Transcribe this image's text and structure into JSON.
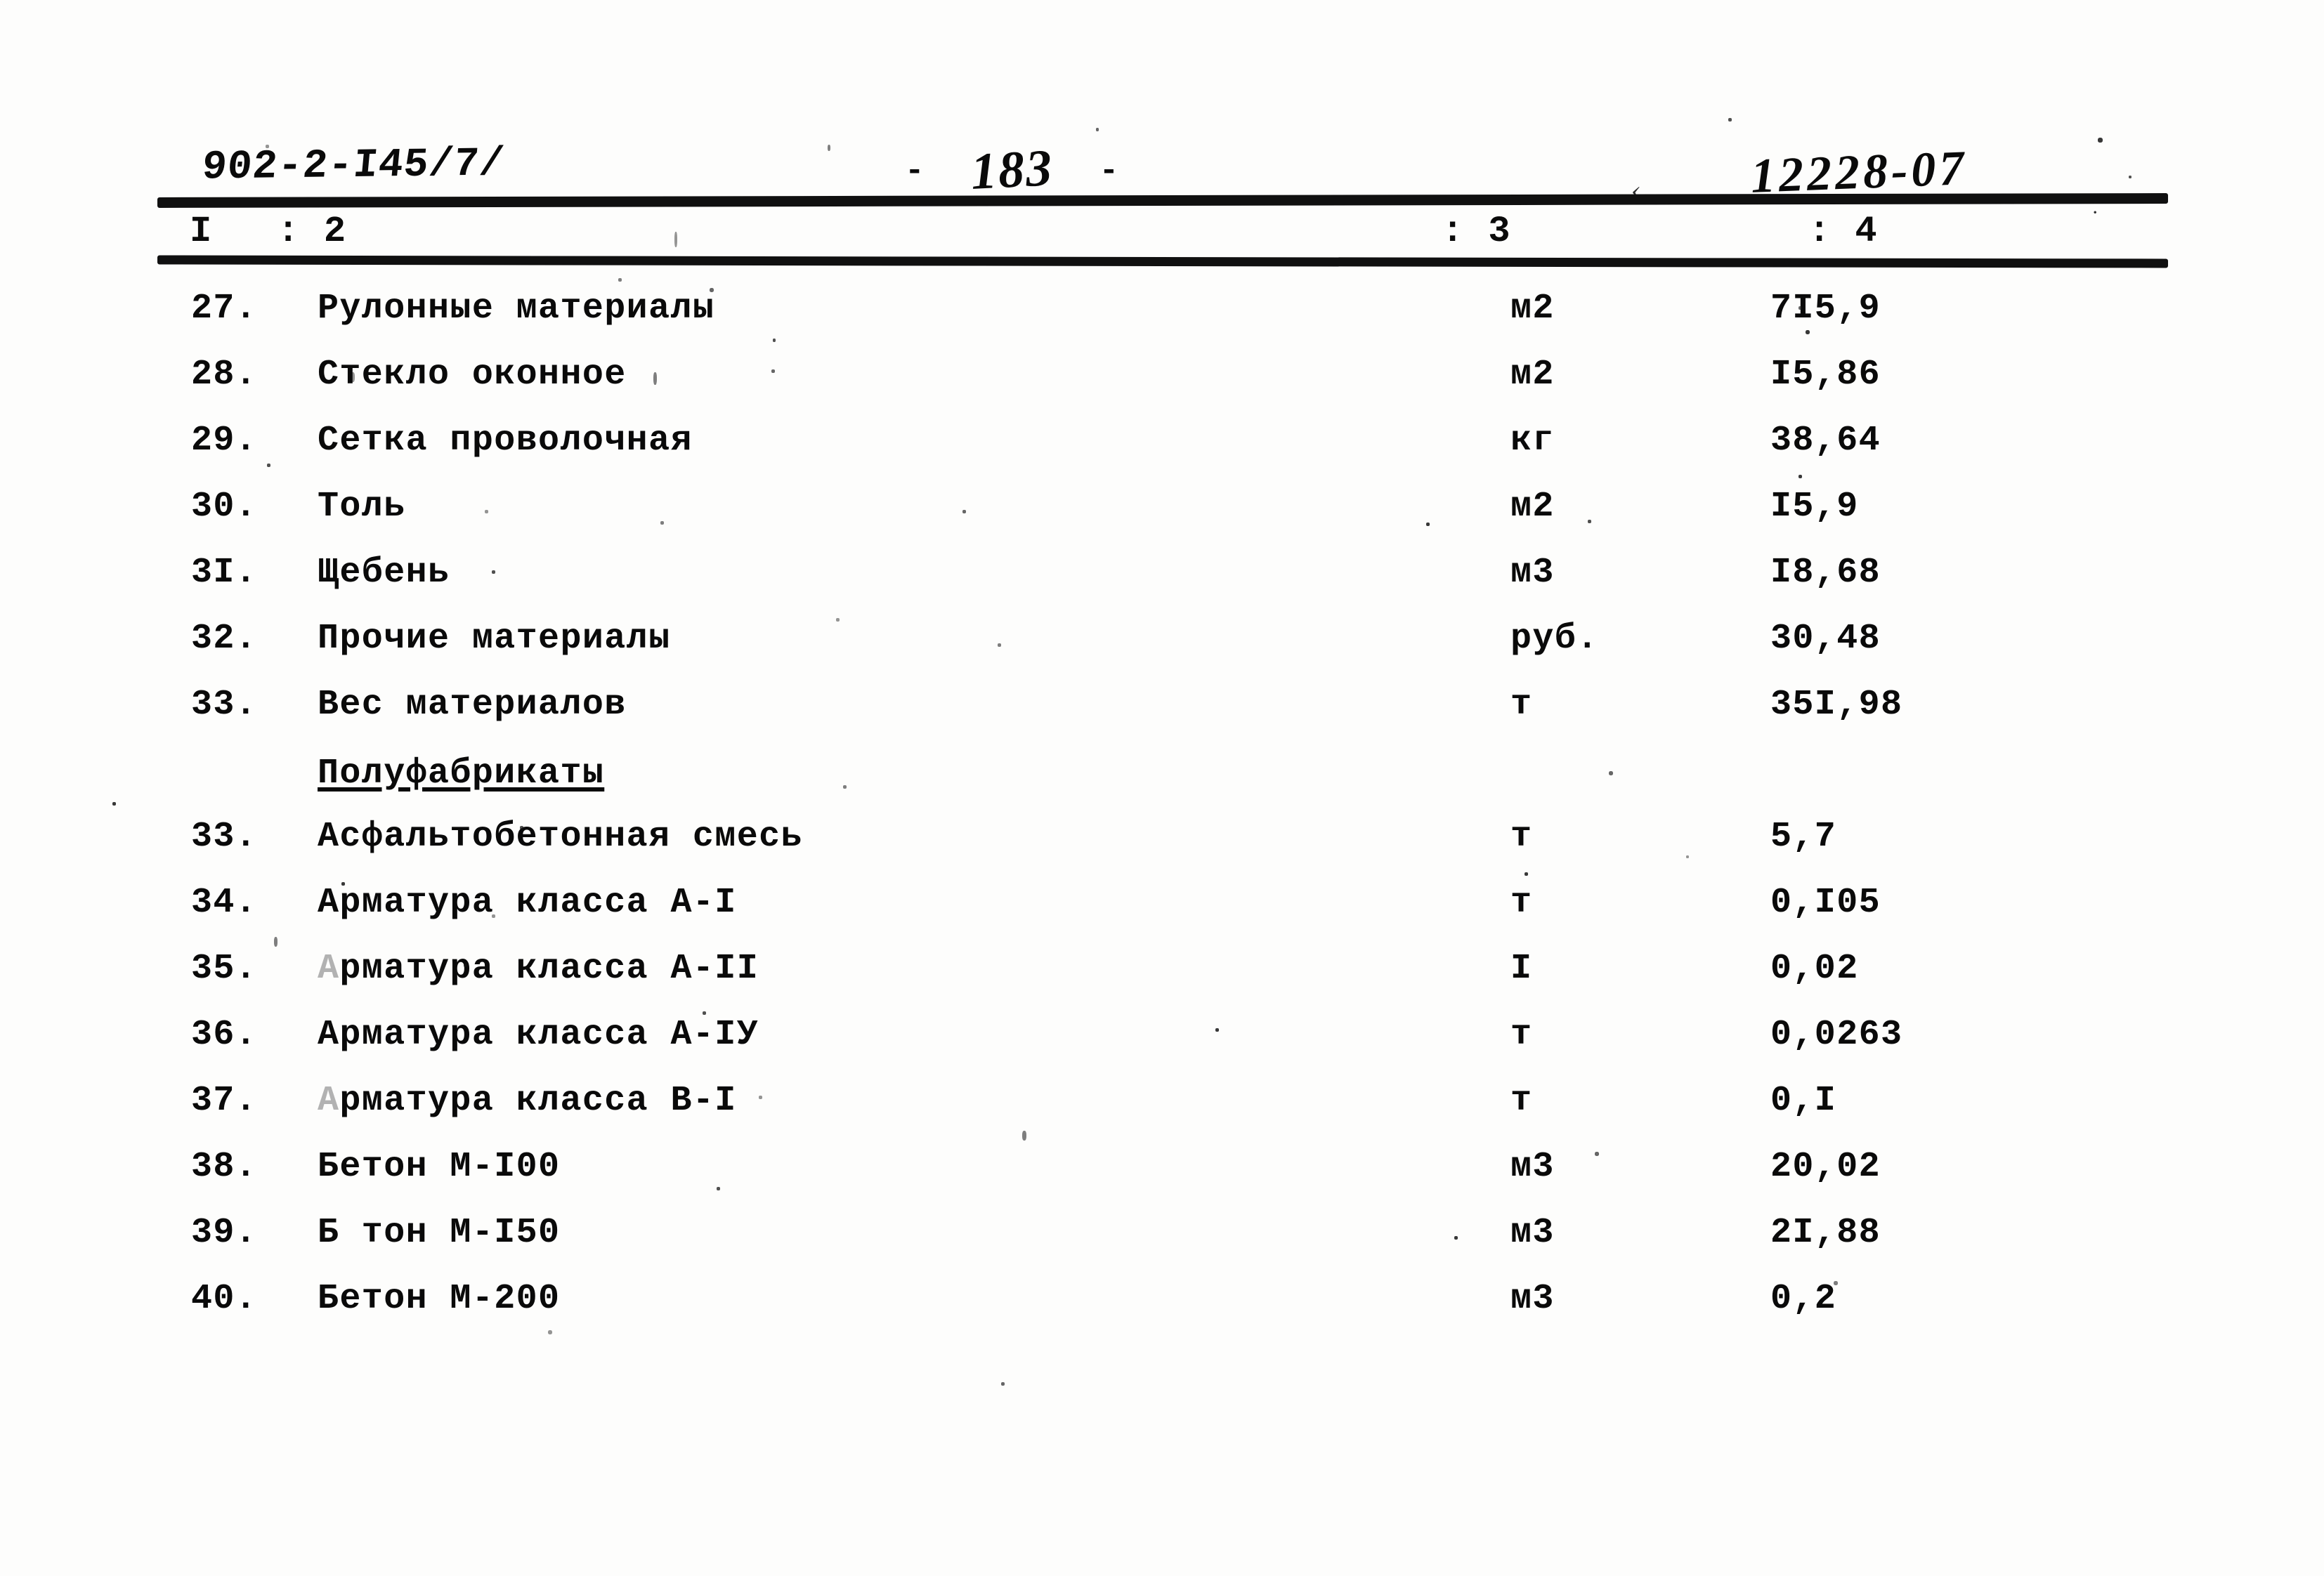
{
  "header": {
    "doc_code": "902-2-I45/7/",
    "page_dash_left": "-",
    "page_number": "183",
    "page_dash_right": "-",
    "job_number": "12228-07"
  },
  "table": {
    "column_headers": {
      "col1": "I",
      "col2": ": 2",
      "col3": ": 3",
      "col4": ": 4"
    },
    "rows": [
      {
        "num": "27.",
        "name": "Рулонные  материалы",
        "unit": "м2",
        "value": "7I5,9"
      },
      {
        "num": "28.",
        "name": "Стекло оконное",
        "unit": "м2",
        "value": "I5,86"
      },
      {
        "num": "29.",
        "name": "Сетка проволочная",
        "unit": "кг",
        "value": "38,64"
      },
      {
        "num": "30.",
        "name": "Толь",
        "unit": "м2",
        "value": "I5,9"
      },
      {
        "num": "3I.",
        "name": "Щебень",
        "unit": "м3",
        "value": "I8,68"
      },
      {
        "num": "32.",
        "name": "Прочие материалы",
        "unit": "руб.",
        "value": "30,48"
      },
      {
        "num": "33.",
        "name": "Вес материалов",
        "unit": "т",
        "value": "35I,98"
      }
    ],
    "subheading": "Полуфабрикаты",
    "rows2": [
      {
        "num": "33.",
        "name": "Асфальтобетонная смесь",
        "unit": "т",
        "value": "5,7"
      },
      {
        "num": "34.",
        "name": "Арматура класса А-I",
        "unit": "т",
        "value": "0,I05"
      },
      {
        "num": "35.",
        "name": "Арматура класса А-II",
        "unit": "I",
        "value": "0,02"
      },
      {
        "num": "36.",
        "name": "Арматура класса  А-IУ",
        "unit": "т",
        "value": "0,0263"
      },
      {
        "num": "37.",
        "name": "Арматура класса В-I",
        "unit": "т",
        "value": "0,I"
      },
      {
        "num": "38.",
        "name": "Бетон М-I00",
        "unit": "м3",
        "value": "20,02"
      },
      {
        "num": "39.",
        "name": "Б тон М-I50",
        "unit": "м3",
        "value": "2I,88"
      },
      {
        "num": "40.",
        "name": "Бетон М-200",
        "unit": "м3",
        "value": "0,2"
      }
    ]
  }
}
